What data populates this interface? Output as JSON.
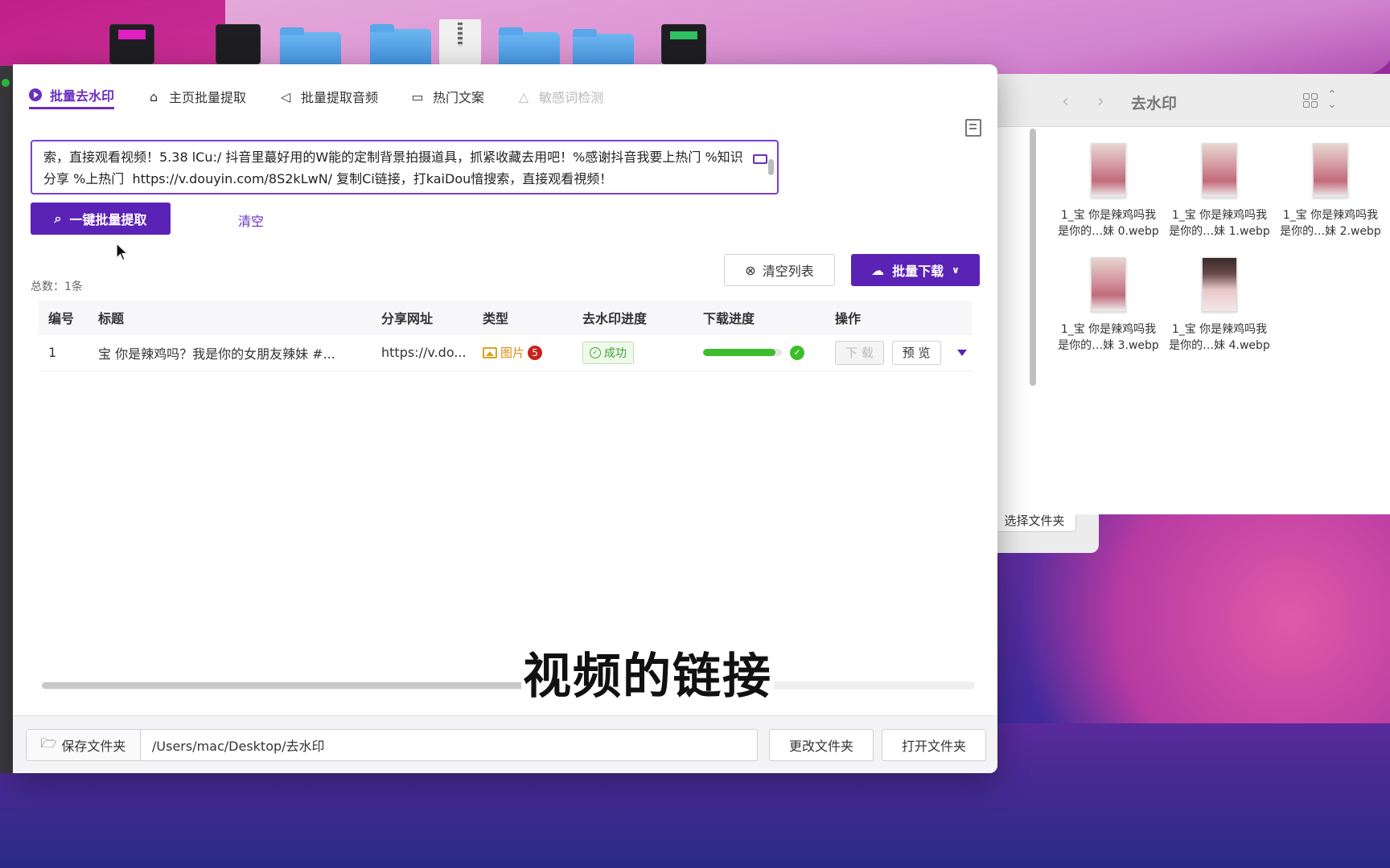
{
  "desktop": {
    "icons": [
      "dark-app-1",
      "dark-app-2",
      "folder",
      "folder",
      "zip-file",
      "folder",
      "folder",
      "dark-app-3"
    ]
  },
  "app": {
    "tabs": [
      {
        "label": "批量去水印",
        "icon": "play-circle-icon",
        "active": true
      },
      {
        "label": "主页批量提取",
        "icon": "home-icon",
        "active": false
      },
      {
        "label": "批量提取音频",
        "icon": "speaker-icon",
        "active": false
      },
      {
        "label": "热门文案",
        "icon": "book-icon",
        "active": false
      },
      {
        "label": "敏感词检测",
        "icon": "warning-icon",
        "disabled": true
      }
    ],
    "input_text": "索，直接观看视频！5.38 lCu:/ 抖音里蕞好用的W能的定制背景拍摄道具，抓紧收藏去用吧！%感谢抖音我要上热门 %知识分享 %上热门  https://v.douyin.com/8S2kLwN/ 复制Ci链接，打kaiDou愔搜索，直接观看視频！",
    "extract_button": "一键批量提取",
    "clear_link": "清空",
    "total_label": "总数：1条",
    "clear_list_button": "清空列表",
    "batch_download_button": "批量下载",
    "table": {
      "headers": [
        "编号",
        "标题",
        "分享网址",
        "类型",
        "去水印进度",
        "下载进度",
        "操作"
      ],
      "rows": [
        {
          "id": "1",
          "title": "宝 你是辣鸡吗？我是你的女朋友辣妹 #...",
          "url": "https://v.do...",
          "type": "图片",
          "count": "5",
          "status": "成功",
          "progress": 1.0,
          "download": "下 载",
          "preview": "预 览"
        }
      ]
    },
    "subtitle": "视频的链接",
    "footer": {
      "save_label": "保存文件夹",
      "path": "/Users/mac/Desktop/去水印",
      "change_button": "更改文件夹",
      "open_button": "打开文件夹"
    },
    "accent_color": "#5b22b6",
    "success_color": "#3dbd2c"
  },
  "finder": {
    "title": "去水印",
    "select_folder_button": "选择文件夹",
    "files": [
      {
        "line1": "1_宝 你是辣鸡吗我",
        "line2": "是你的…妹 0.webp"
      },
      {
        "line1": "1_宝 你是辣鸡吗我",
        "line2": "是你的…妹 1.webp"
      },
      {
        "line1": "1_宝 你是辣鸡吗我",
        "line2": "是你的…妹 2.webp"
      },
      {
        "line1": "1_宝 你是辣鸡吗我",
        "line2": "是你的…妹 3.webp"
      },
      {
        "line1": "1_宝 你是辣鸡吗我",
        "line2": "是你的…妹 4.webp"
      }
    ]
  }
}
